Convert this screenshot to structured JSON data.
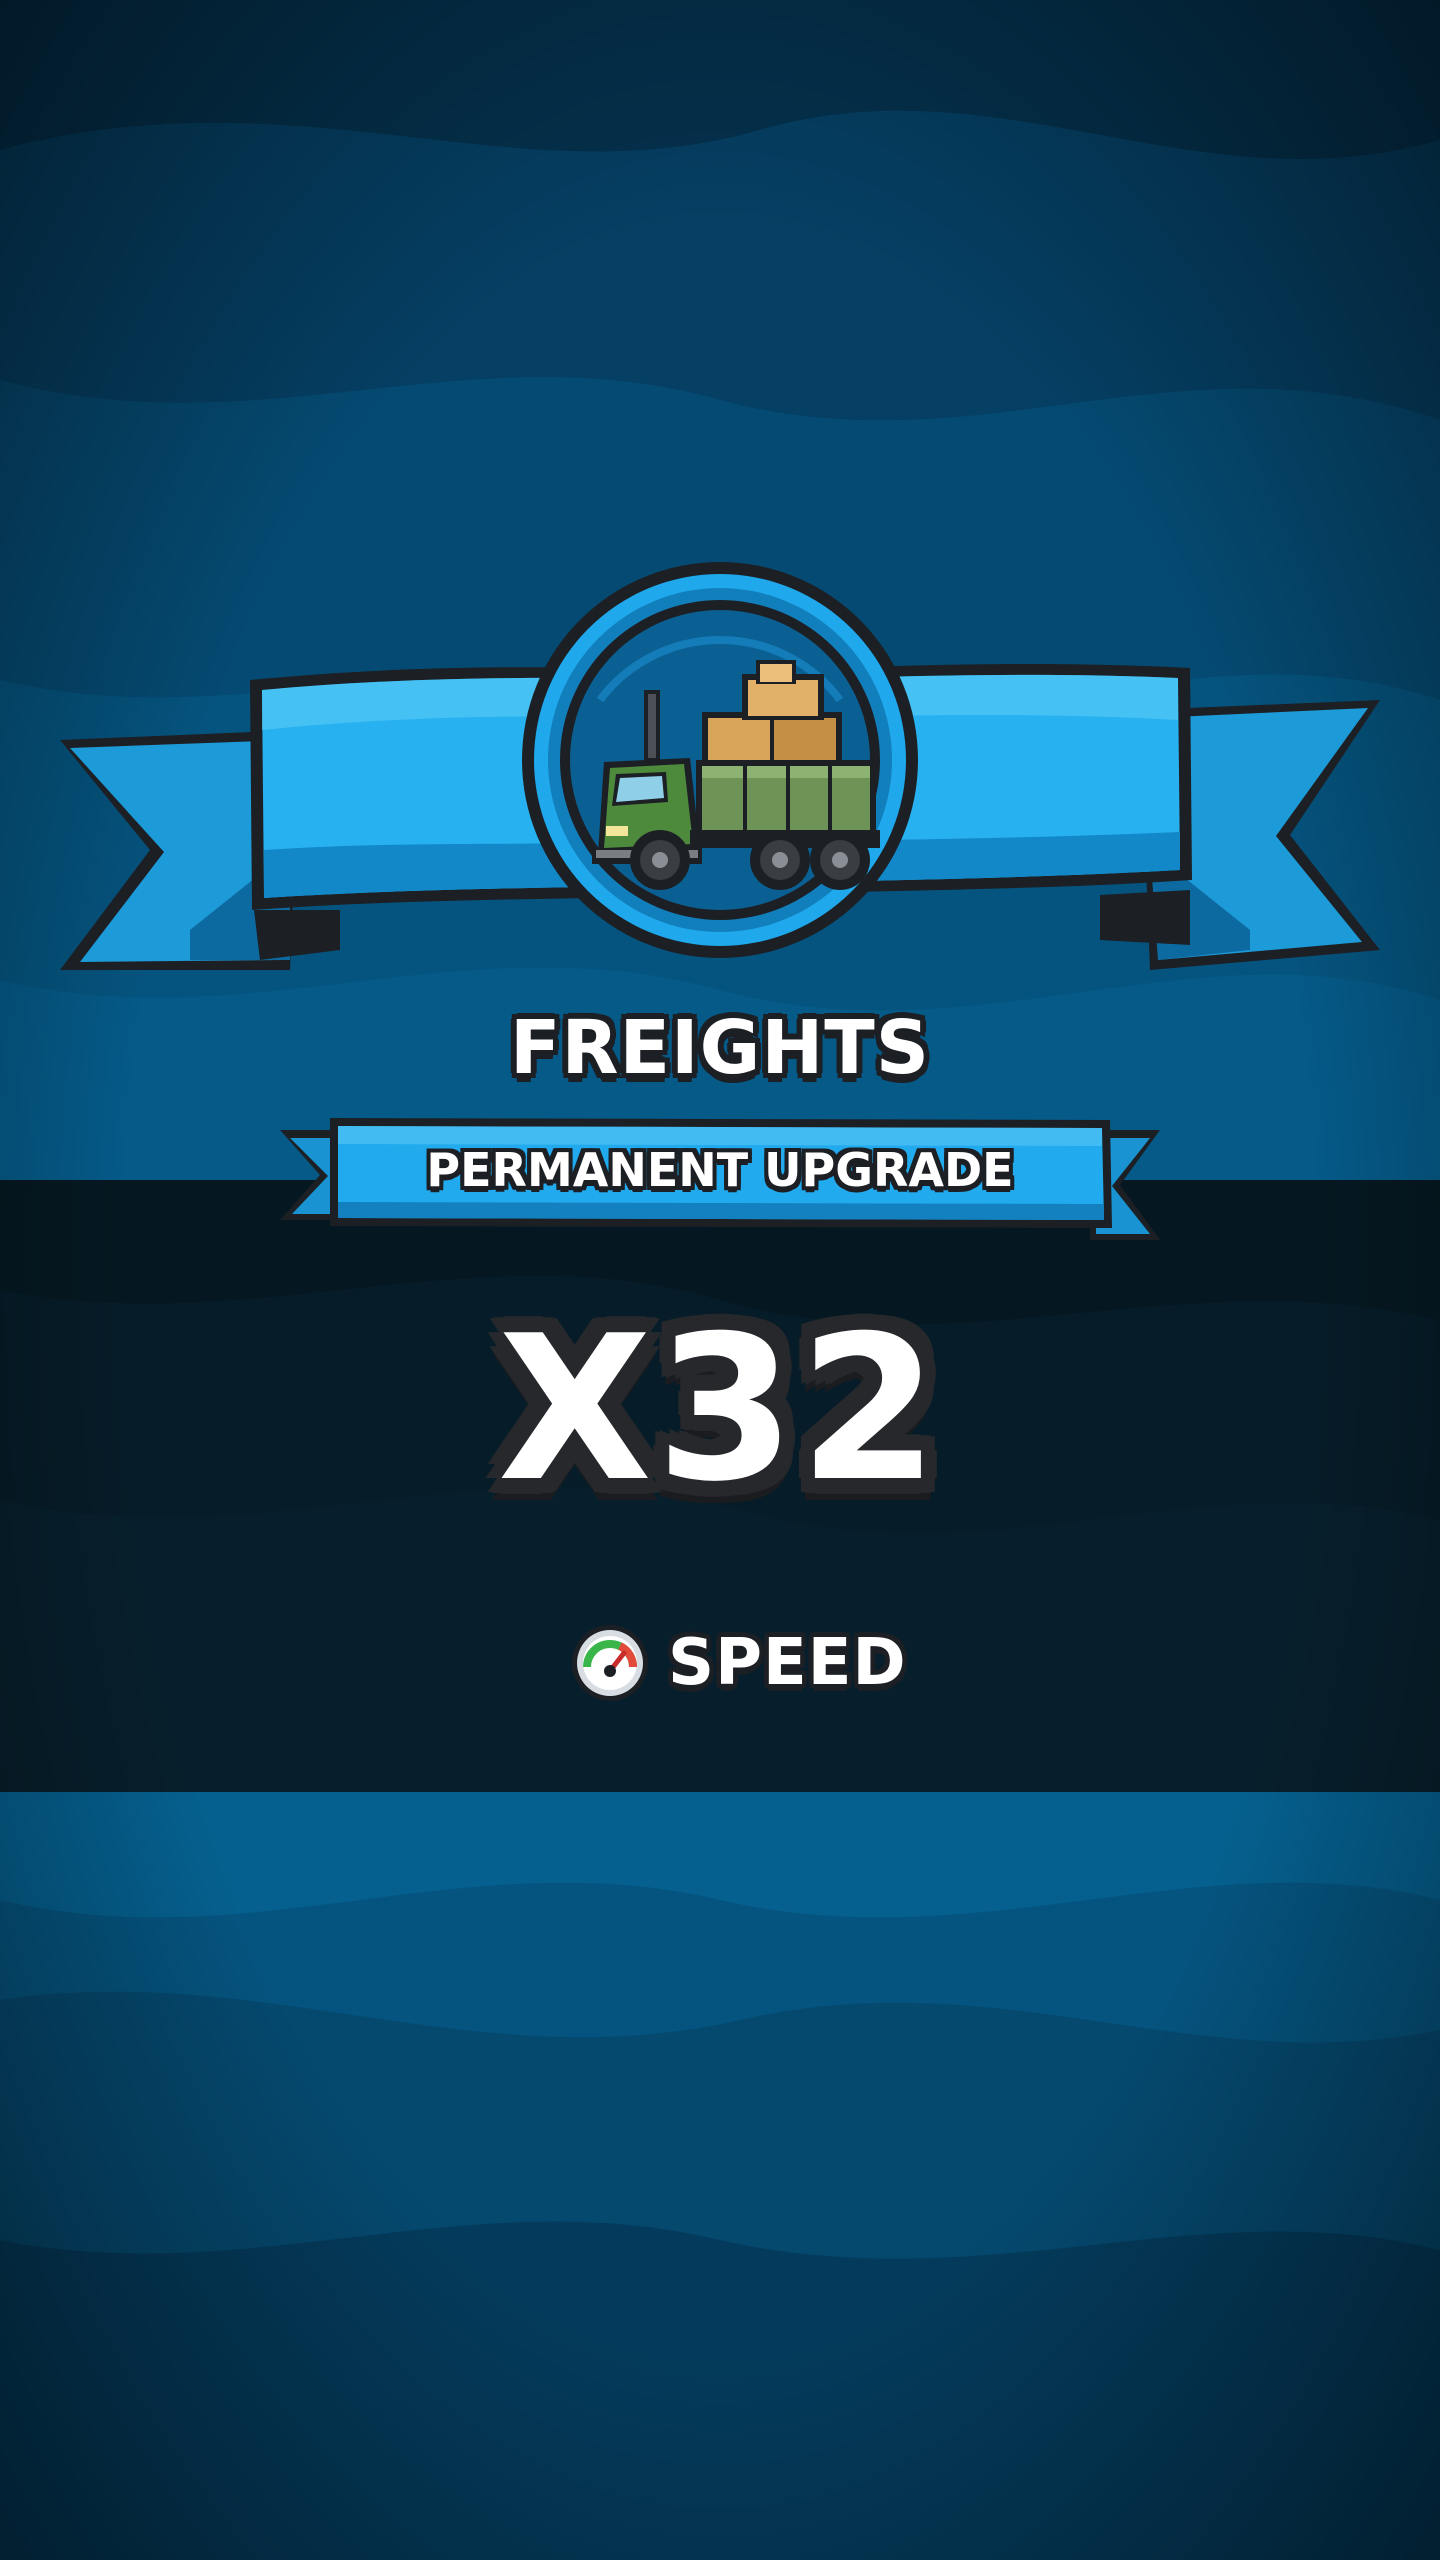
{
  "reward": {
    "title": "FREIGHTS",
    "subtitle": "PERMANENT UPGRADE",
    "multiplier": "X32",
    "stat": {
      "label": "SPEED",
      "icon": "speedometer-icon"
    },
    "badge_icon": "freight-truck-icon"
  },
  "colors": {
    "background": "#04496f",
    "band": "#061a25",
    "ribbon": "#1aa6ea",
    "ribbon_dark": "#0b6fa7",
    "outline": "#1c1f24",
    "text": "#ffffff"
  }
}
